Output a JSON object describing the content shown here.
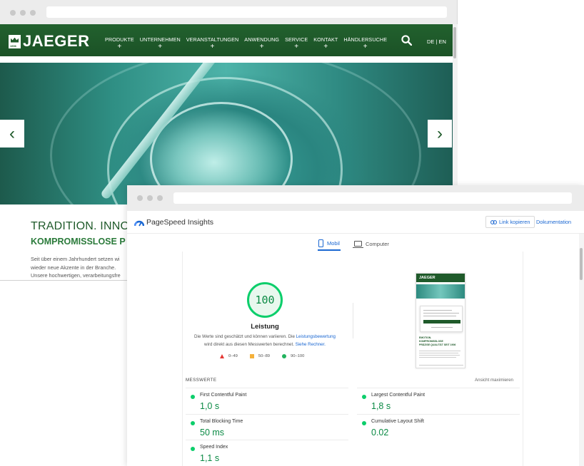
{
  "site": {
    "logo_text": "JAEGER",
    "logo_year": "1906",
    "nav": [
      {
        "label": "PRODUKTE",
        "plus": "+"
      },
      {
        "label": "UNTERNEHMEN",
        "plus": "+"
      },
      {
        "label": "VERANSTALTUNGEN",
        "plus": "+"
      },
      {
        "label": "ANWENDUNG",
        "plus": "+"
      },
      {
        "label": "SERVICE",
        "plus": "+"
      },
      {
        "label": "KONTAKT",
        "plus": "+"
      },
      {
        "label": "HÄNDLERSUCHE",
        "plus": "+"
      }
    ],
    "lang": "DE | EN",
    "prev_arrow": "‹",
    "next_arrow": "›",
    "headline": "TRADITION. INNOV",
    "subheadline": "KOMPROMISSLOSE P",
    "body_lines": [
      "Seit über einem Jahrhundert setzen wi",
      "wieder neue Akzente in der Branche.",
      "Unsere hochwertigen, verarbeitungsfre"
    ],
    "brand_color": "#1f5a2a"
  },
  "psi": {
    "app_title": "PageSpeed Insights",
    "copy_link": "Link kopieren",
    "docs": "Dokumentation",
    "tabs": [
      {
        "label": "Mobil",
        "active": true
      },
      {
        "label": "Computer",
        "active": false
      }
    ],
    "score": "100",
    "score_label": "Leistung",
    "desc_part1": "Die Werte sind geschätzt und können variieren. Die ",
    "desc_link1": "Leistungsbewertung",
    "desc_part2": "wird direkt aus diesen Messwerten berechnet. ",
    "desc_link2": "Siehe Rechner.",
    "legend": [
      {
        "symbol": "triangle",
        "range": "0–49",
        "color": "#e53935"
      },
      {
        "symbol": "square",
        "range": "50–89",
        "color": "#f5b13b"
      },
      {
        "symbol": "circle",
        "range": "90–100",
        "color": "#22b35e"
      }
    ],
    "preview": {
      "logo": "JAEGER",
      "headline_lines": [
        "EMOTION.",
        "KOMPROMISSLOSE",
        "PRÄZISE QUALITÄT SEIT 1906"
      ]
    },
    "metrics_header": "MESSWERTE",
    "metrics_expand": "Ansicht maximieren",
    "metrics": [
      {
        "name": "First Contentful Paint",
        "value": "1,0 s"
      },
      {
        "name": "Largest Contentful Paint",
        "value": "1,8 s"
      },
      {
        "name": "Total Blocking Time",
        "value": "50 ms"
      },
      {
        "name": "Cumulative Layout Shift",
        "value": "0.02"
      },
      {
        "name": "Speed Index",
        "value": "1,1 s"
      }
    ],
    "good_color": "#0cce6b",
    "link_color": "#1a67d2"
  }
}
